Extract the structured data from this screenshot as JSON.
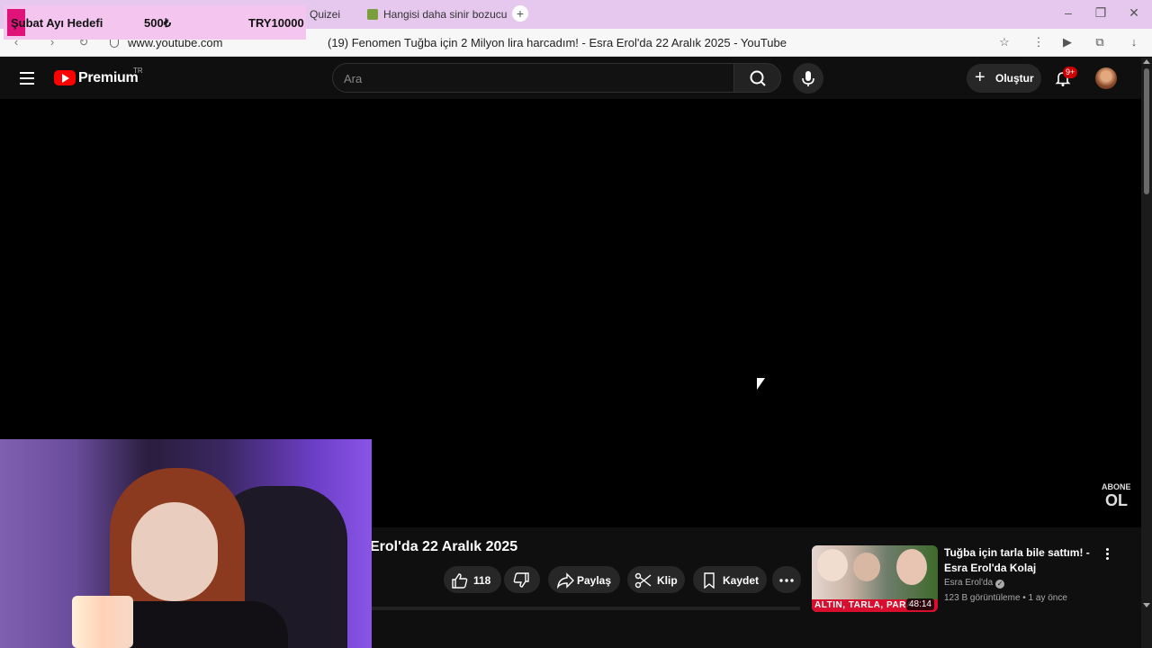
{
  "browser": {
    "tabs": [
      {
        "label": "Quizei"
      },
      {
        "label": "Hangisi daha sinir bozucu"
      }
    ],
    "url": "www.youtube.com",
    "page_title": "(19) Fenomen Tuğba için 2 Milyon lira harcadım! - Esra Erol'da 22 Aralık 2025 - YouTube"
  },
  "goal_overlay": {
    "label": "Şubat Ayı Hedefi",
    "current": "500₺",
    "target": "TRY10000"
  },
  "youtube": {
    "brand": "Premium",
    "country": "TR",
    "search_placeholder": "Ara",
    "create_label": "Oluştur",
    "notification_count": "9+"
  },
  "player": {
    "watermark_small": "ABONE",
    "watermark_big": "OL"
  },
  "video": {
    "title_visible": "Erol'da 22 Aralık 2025",
    "likes": "118",
    "share_label": "Paylaş",
    "clip_label": "Klip",
    "save_label": "Kaydet"
  },
  "recommended": {
    "title": "Tuğba için tarla bile sattım! - Esra Erol'da Kolaj",
    "channel": "Esra Erol'da",
    "meta": "123 B görüntüleme • 1 ay önce",
    "duration": "48:14",
    "thumb_caption": "ALTIN, TARLA, PARA"
  },
  "colors": {
    "yt_red": "#ff0000",
    "goal_bg": "#f4c6ef",
    "goal_accent": "#e0137a",
    "tab_strip": "#e6c8ee"
  }
}
